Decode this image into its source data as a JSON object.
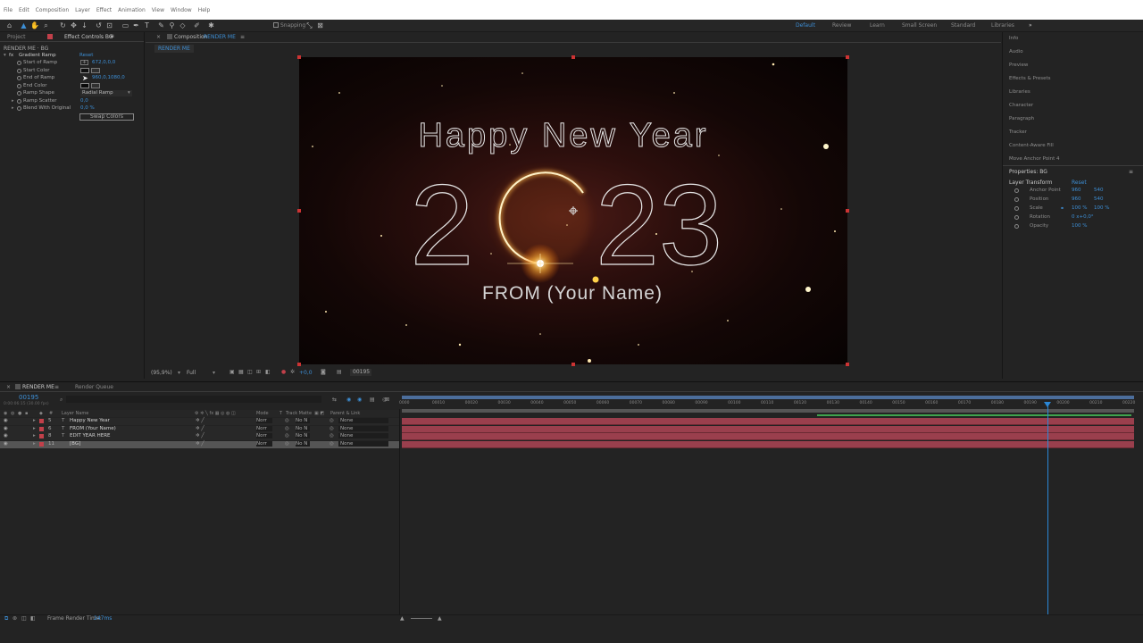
{
  "menu": [
    "File",
    "Edit",
    "Composition",
    "Layer",
    "Effect",
    "Animation",
    "View",
    "Window",
    "Help"
  ],
  "toolbar": {
    "snapping": "Snapping"
  },
  "workspaces": [
    "Default",
    "Review",
    "Learn",
    "Small Screen",
    "Standard",
    "Libraries"
  ],
  "left_panel": {
    "tabs": [
      "Project",
      "Effect Controls BG"
    ],
    "breadcrumb": "RENDER ME · BG",
    "effect_name": "Gradient Ramp",
    "reset": "Reset",
    "props": [
      {
        "label": "Start of Ramp",
        "value": "672,0,0,0"
      },
      {
        "label": "Start Color",
        "value": ""
      },
      {
        "label": "End of Ramp",
        "value": "960,0,1080,0"
      },
      {
        "label": "End Color",
        "value": ""
      },
      {
        "label": "Ramp Shape",
        "value": "Radial Ramp"
      },
      {
        "label": "Ramp Scatter",
        "value": "0,0"
      },
      {
        "label": "Blend With Original",
        "value": "0,0 %"
      }
    ],
    "swap": "Swap Colors"
  },
  "comp_panel": {
    "tab": "Composition",
    "tab_name": "RENDER ME",
    "crumb": "RENDER ME",
    "canvas": {
      "line1": "Happy New Year",
      "year_a": "2",
      "year_b": "23",
      "line3": "FROM (Your Name)"
    },
    "footer": {
      "zoom": "(95,9%)",
      "res": "Full",
      "exposure": "+0,0",
      "frame": "00195"
    }
  },
  "right_panel": {
    "items": [
      "Info",
      "Audio",
      "Preview",
      "Effects & Presets",
      "Libraries",
      "Character",
      "Paragraph",
      "Tracker",
      "Content-Aware Fill",
      "Move Anchor Point 4"
    ],
    "props_title": "Properties: BG",
    "group": "Layer Transform",
    "reset": "Reset",
    "rows": [
      {
        "label": "Anchor Point",
        "v1": "960",
        "v2": "540"
      },
      {
        "label": "Position",
        "v1": "960",
        "v2": "540"
      },
      {
        "label": "Scale",
        "v1": "100 %",
        "v2": "100 %"
      },
      {
        "label": "Rotation",
        "v1": "0 x+0,0°",
        "v2": ""
      },
      {
        "label": "Opacity",
        "v1": "100 %",
        "v2": ""
      }
    ]
  },
  "timeline": {
    "tabs": [
      "RENDER ME",
      "Render Queue"
    ],
    "timecode": "00195",
    "fps": "0:00:06:15 (30.00 fps)",
    "columns": {
      "layer": "Layer Name",
      "mode": "Mode",
      "t": "T",
      "matte": "Track Matte",
      "parent": "Parent & Link"
    },
    "layers": [
      {
        "num": "5",
        "name": "Happy New Year",
        "type": "T",
        "mode": "Norr",
        "matte": "No N",
        "parent": "None",
        "color": "#c2404a"
      },
      {
        "num": "6",
        "name": "FROM (Your Name)",
        "type": "T",
        "mode": "Norr",
        "matte": "No N",
        "parent": "None",
        "color": "#c2404a"
      },
      {
        "num": "8",
        "name": "EDIT YEAR HERE",
        "type": "T",
        "mode": "Norr",
        "matte": "No N",
        "parent": "None",
        "color": "#c2404a"
      },
      {
        "num": "11",
        "name": "[BG]",
        "type": "",
        "mode": "Norr",
        "matte": "No N",
        "parent": "None",
        "color": "#c2404a"
      }
    ],
    "ticks": [
      "0000",
      "00010",
      "00020",
      "00030",
      "00040",
      "00050",
      "00060",
      "00070",
      "00080",
      "00090",
      "00100",
      "00110",
      "00120",
      "00130",
      "00140",
      "00150",
      "00160",
      "00170",
      "00180",
      "00190",
      "00200",
      "00210",
      "00220"
    ],
    "playhead_frame": 195,
    "total_frames": 220
  },
  "footer": {
    "render_label": "Frame Render Time:",
    "render_value": "247ms"
  }
}
